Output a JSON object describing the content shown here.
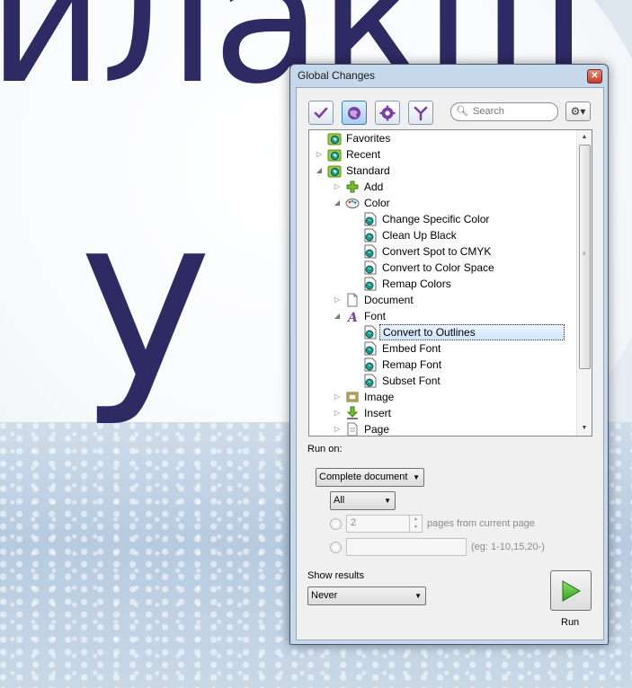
{
  "background": {
    "text_line1": "илакш",
    "text_line2": "у Д"
  },
  "dialog": {
    "title": "Global Changes",
    "close_glyph": "✕"
  },
  "toolbar": {
    "buttons": [
      {
        "name": "checkmark-icon",
        "active": false
      },
      {
        "name": "globe-icon",
        "active": true
      },
      {
        "name": "gear-badge-icon",
        "active": false
      },
      {
        "name": "branch-icon",
        "active": false
      }
    ],
    "search_placeholder": "Search",
    "options_glyph": "⚙▾"
  },
  "tree": {
    "items": [
      {
        "label": "Favorites",
        "icon": "folder-globe-icon",
        "level": 0,
        "expander": "",
        "selected": false
      },
      {
        "label": "Recent",
        "icon": "folder-globe-icon",
        "level": 0,
        "expander": "▷",
        "selected": false
      },
      {
        "label": "Standard",
        "icon": "folder-globe-icon",
        "level": 0,
        "expander": "◢",
        "selected": false
      },
      {
        "label": "Add",
        "icon": "plus-icon",
        "level": 1,
        "expander": "▷",
        "selected": false
      },
      {
        "label": "Color",
        "icon": "palette-icon",
        "level": 1,
        "expander": "◢",
        "selected": false
      },
      {
        "label": "Change Specific Color",
        "icon": "action-doc-icon",
        "level": 2,
        "expander": "",
        "selected": false
      },
      {
        "label": "Clean Up Black",
        "icon": "action-doc-icon",
        "level": 2,
        "expander": "",
        "selected": false
      },
      {
        "label": "Convert Spot to CMYK",
        "icon": "action-doc-icon",
        "level": 2,
        "expander": "",
        "selected": false
      },
      {
        "label": "Convert to Color Space",
        "icon": "action-doc-icon",
        "level": 2,
        "expander": "",
        "selected": false
      },
      {
        "label": "Remap Colors",
        "icon": "action-doc-icon",
        "level": 2,
        "expander": "",
        "selected": false
      },
      {
        "label": "Document",
        "icon": "document-icon",
        "level": 1,
        "expander": "▷",
        "selected": false
      },
      {
        "label": "Font",
        "icon": "font-icon",
        "level": 1,
        "expander": "◢",
        "selected": false
      },
      {
        "label": "Convert to Outlines",
        "icon": "action-doc-icon",
        "level": 2,
        "expander": "",
        "selected": true
      },
      {
        "label": "Embed Font",
        "icon": "action-doc-icon",
        "level": 2,
        "expander": "",
        "selected": false
      },
      {
        "label": "Remap Font",
        "icon": "action-doc-icon",
        "level": 2,
        "expander": "",
        "selected": false
      },
      {
        "label": "Subset Font",
        "icon": "action-doc-icon",
        "level": 2,
        "expander": "",
        "selected": false
      },
      {
        "label": "Image",
        "icon": "image-icon",
        "level": 1,
        "expander": "▷",
        "selected": false
      },
      {
        "label": "Insert",
        "icon": "insert-icon",
        "level": 1,
        "expander": "▷",
        "selected": false
      },
      {
        "label": "Page",
        "icon": "page-icon",
        "level": 1,
        "expander": "▷",
        "selected": false
      }
    ]
  },
  "run_on": {
    "label": "Run on:",
    "scope_value": "Complete document",
    "pages_value": "All",
    "pages_count": "2",
    "pages_suffix": "pages from current page",
    "range_hint": "(eg: 1-10,15,20-)"
  },
  "show_results": {
    "label": "Show results",
    "value": "Never"
  },
  "run": {
    "label": "Run"
  },
  "colors": {
    "bg_text": "#2e2a63",
    "accent_green": "#2e9e1f",
    "selection": "#cfe3fb"
  }
}
